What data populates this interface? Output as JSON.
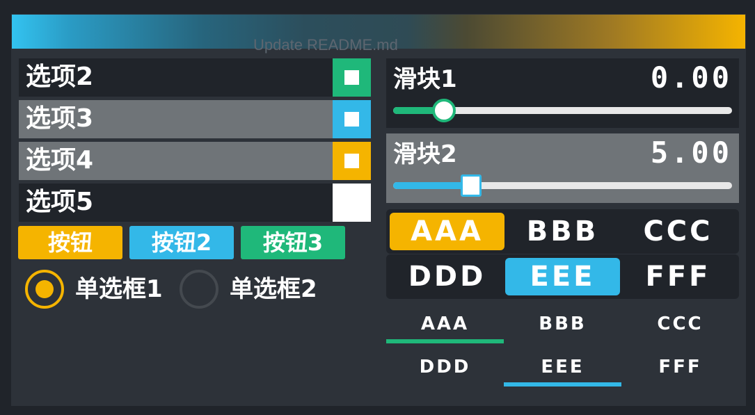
{
  "background_caption": "Update README.md",
  "colors": {
    "green": "#1fb87a",
    "blue": "#33b8e8",
    "yellow": "#f5b400",
    "dark": "#20242a",
    "gray": "#6f7478",
    "panel": "#2d3239"
  },
  "options": [
    {
      "label": "选项2",
      "checkbox_color": "#1fb87a",
      "checked": true
    },
    {
      "label": "选项3",
      "checkbox_color": "#33b8e8",
      "checked": true
    },
    {
      "label": "选项4",
      "checkbox_color": "#f5b400",
      "checked": true
    },
    {
      "label": "选项5",
      "checkbox_color": "#ffffff",
      "checked": false
    }
  ],
  "buttons": [
    {
      "label": "按钮",
      "color": "#f5b400"
    },
    {
      "label": "按钮2",
      "color": "#33b8e8"
    },
    {
      "label": "按钮3",
      "color": "#1fb87a"
    }
  ],
  "radios": [
    {
      "label": "单选框1",
      "selected": true
    },
    {
      "label": "单选框2",
      "selected": false
    }
  ],
  "sliders": [
    {
      "title": "滑块1",
      "value_text": "0.00",
      "fraction": 0.15,
      "color": "#1fb87a"
    },
    {
      "title": "滑块2",
      "value_text": "5.00",
      "fraction": 0.23,
      "color": "#33b8e8"
    }
  ],
  "segments": {
    "row1": [
      {
        "label": "AAA",
        "selected": true
      },
      {
        "label": "BBB",
        "selected": false
      },
      {
        "label": "CCC",
        "selected": false
      }
    ],
    "row2": [
      {
        "label": "DDD",
        "selected": false
      },
      {
        "label": "EEE",
        "selected": true
      },
      {
        "label": "FFF",
        "selected": false
      }
    ]
  },
  "tabs": {
    "row1": [
      {
        "label": "AAA",
        "active": true
      },
      {
        "label": "BBB",
        "active": false
      },
      {
        "label": "CCC",
        "active": false
      }
    ],
    "row2": [
      {
        "label": "DDD",
        "active": false
      },
      {
        "label": "EEE",
        "active": true
      },
      {
        "label": "FFF",
        "active": false
      }
    ]
  }
}
